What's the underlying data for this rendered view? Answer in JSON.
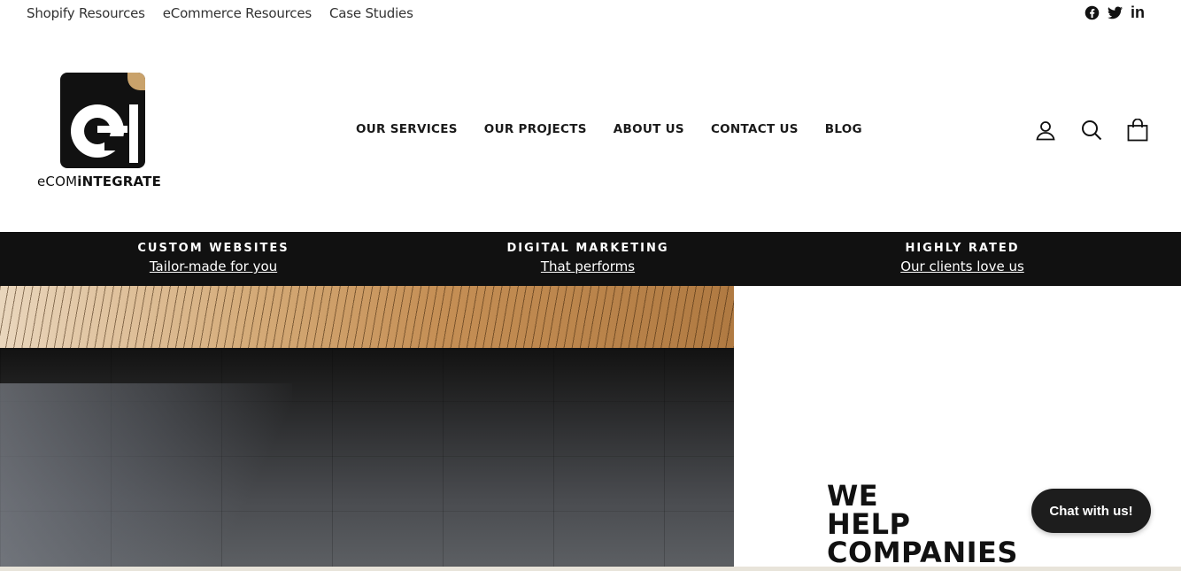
{
  "utility_nav": {
    "links": [
      "Shopify Resources",
      "eCommerce Resources",
      "Case Studies"
    ],
    "social": [
      {
        "name": "facebook-icon",
        "label": "Facebook"
      },
      {
        "name": "twitter-icon",
        "label": "Twitter"
      },
      {
        "name": "linkedin-icon",
        "label": "in"
      }
    ]
  },
  "brand": {
    "text_light": "eCOM",
    "text_bold": "iNTEGRATE",
    "mark": "ei",
    "accent_color": "#c9a26b"
  },
  "main_nav": {
    "items": [
      "OUR SERVICES",
      "OUR PROJECTS",
      "ABOUT US",
      "CONTACT US",
      "BLOG"
    ]
  },
  "header_icons": [
    "account-icon",
    "search-icon",
    "cart-icon"
  ],
  "promo_bar": {
    "items": [
      {
        "title": "CUSTOM WEBSITES",
        "subtitle": "Tailor-made for you"
      },
      {
        "title": "DIGITAL MARKETING",
        "subtitle": "That performs"
      },
      {
        "title": "HIGHLY RATED",
        "subtitle": "Our clients love us"
      }
    ]
  },
  "hero": {
    "heading_lines": [
      "WE",
      "HELP",
      "COMPANIES"
    ]
  },
  "chat": {
    "label": "Chat with us!"
  }
}
